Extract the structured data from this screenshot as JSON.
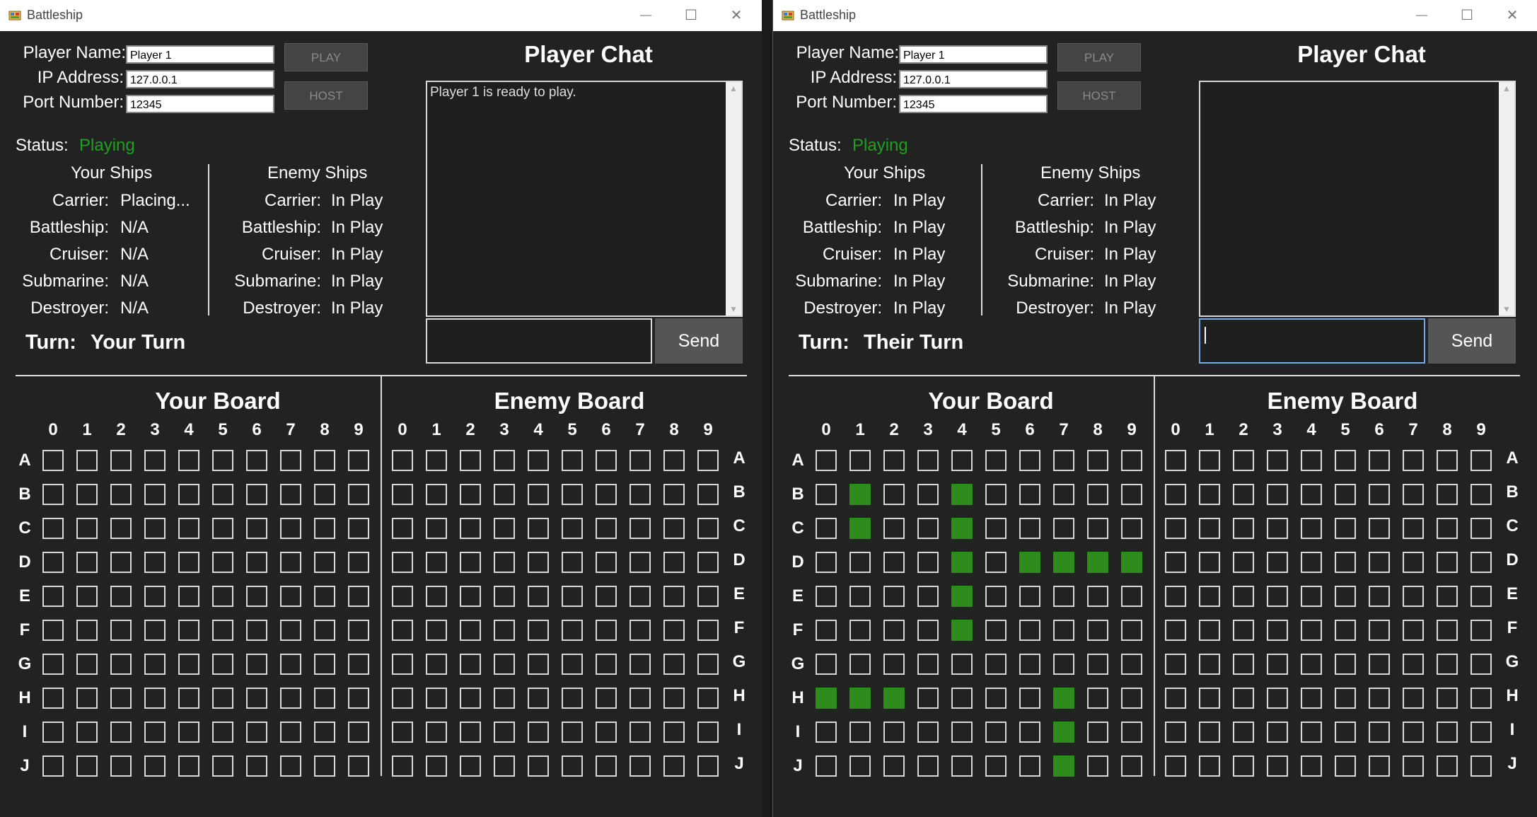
{
  "left": {
    "title": "Battleship",
    "player_name_label": "Player Name:",
    "player_name_value": "Player 1",
    "ip_label": "IP Address:",
    "ip_value": "127.0.0.1",
    "port_label": "Port Number:",
    "port_value": "12345",
    "play_label": "PLAY",
    "host_label": "HOST",
    "status_label": "Status:",
    "status_value": "Playing",
    "your_ships_title": "Your Ships",
    "enemy_ships_title": "Enemy Ships",
    "your_ships": [
      {
        "name": "Carrier:",
        "state": "Placing..."
      },
      {
        "name": "Battleship:",
        "state": "N/A"
      },
      {
        "name": "Cruiser:",
        "state": "N/A"
      },
      {
        "name": "Submarine:",
        "state": "N/A"
      },
      {
        "name": "Destroyer:",
        "state": "N/A"
      }
    ],
    "enemy_ships": [
      {
        "name": "Carrier:",
        "state": "In Play"
      },
      {
        "name": "Battleship:",
        "state": "In Play"
      },
      {
        "name": "Cruiser:",
        "state": "In Play"
      },
      {
        "name": "Submarine:",
        "state": "In Play"
      },
      {
        "name": "Destroyer:",
        "state": "In Play"
      }
    ],
    "turn_label": "Turn:",
    "turn_value": "Your Turn",
    "chat_title": "Player Chat",
    "chat_messages": "Player 1 is ready to play.",
    "send_label": "Send",
    "your_board_title": "Your Board",
    "enemy_board_title": "Enemy Board",
    "your_board_ships": []
  },
  "right": {
    "title": "Battleship",
    "player_name_label": "Player Name:",
    "player_name_value": "Player 1",
    "ip_label": "IP Address:",
    "ip_value": "127.0.0.1",
    "port_label": "Port Number:",
    "port_value": "12345",
    "play_label": "PLAY",
    "host_label": "HOST",
    "status_label": "Status:",
    "status_value": "Playing",
    "your_ships_title": "Your Ships",
    "enemy_ships_title": "Enemy Ships",
    "your_ships": [
      {
        "name": "Carrier:",
        "state": "In Play"
      },
      {
        "name": "Battleship:",
        "state": "In Play"
      },
      {
        "name": "Cruiser:",
        "state": "In Play"
      },
      {
        "name": "Submarine:",
        "state": "In Play"
      },
      {
        "name": "Destroyer:",
        "state": "In Play"
      }
    ],
    "enemy_ships": [
      {
        "name": "Carrier:",
        "state": "In Play"
      },
      {
        "name": "Battleship:",
        "state": "In Play"
      },
      {
        "name": "Cruiser:",
        "state": "In Play"
      },
      {
        "name": "Submarine:",
        "state": "In Play"
      },
      {
        "name": "Destroyer:",
        "state": "In Play"
      }
    ],
    "turn_label": "Turn:",
    "turn_value": "Their Turn",
    "chat_title": "Player Chat",
    "chat_messages": "",
    "send_label": "Send",
    "your_board_title": "Your Board",
    "enemy_board_title": "Enemy Board",
    "your_board_ships": [
      "B1",
      "C1",
      "B4",
      "C4",
      "D4",
      "E4",
      "F4",
      "D6",
      "D7",
      "D8",
      "D9",
      "H0",
      "H1",
      "H2",
      "H7",
      "I7",
      "J7"
    ]
  },
  "board": {
    "columns": [
      "0",
      "1",
      "2",
      "3",
      "4",
      "5",
      "6",
      "7",
      "8",
      "9"
    ],
    "rows": [
      "A",
      "B",
      "C",
      "D",
      "E",
      "F",
      "G",
      "H",
      "I",
      "J"
    ]
  },
  "icons": {
    "app": "battleship-app-icon",
    "minimize": "minimize-icon",
    "maximize": "maximize-icon",
    "close": "close-icon"
  },
  "colors": {
    "ship": "#2e8b1e",
    "status": "#1fa11f",
    "background": "#222222"
  }
}
